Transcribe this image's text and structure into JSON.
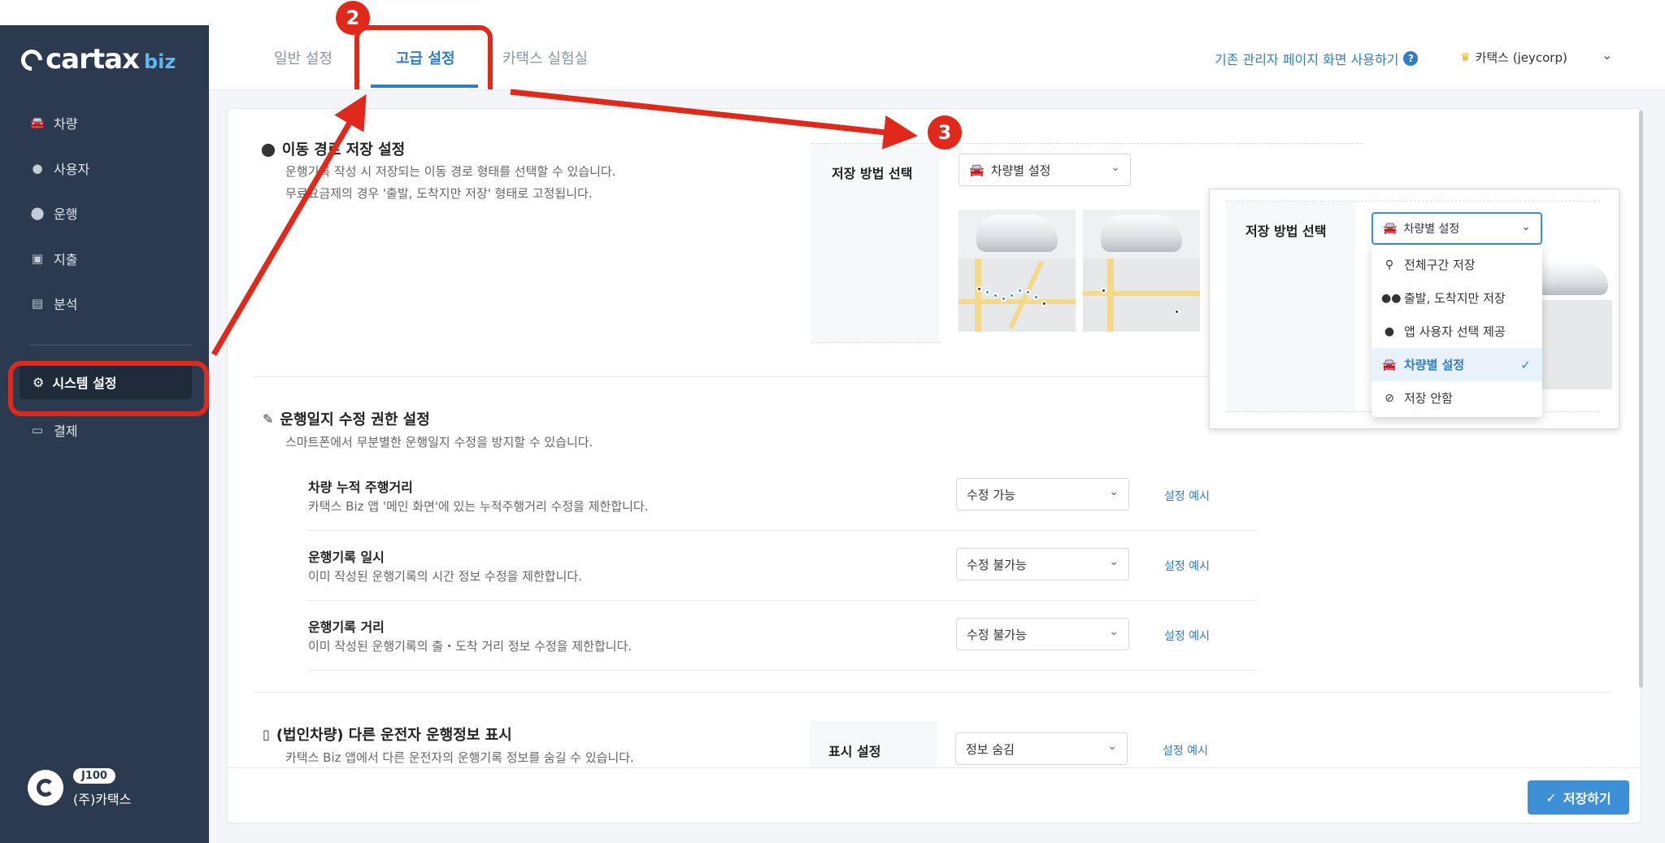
{
  "brand": {
    "name": "cartax",
    "suffix": "biz"
  },
  "sidebar": {
    "items": [
      {
        "label": "차량",
        "icon": "car-icon"
      },
      {
        "label": "사용자",
        "icon": "user-icon"
      },
      {
        "label": "운행",
        "icon": "location-pin-icon"
      },
      {
        "label": "지출",
        "icon": "expense-icon"
      },
      {
        "label": "분석",
        "icon": "chart-icon"
      }
    ],
    "system_settings": "시스템 설정",
    "payment": "결제",
    "user": {
      "plan": "J100",
      "company": "(주)카택스"
    }
  },
  "tabs": [
    {
      "label": "일반 설정",
      "active": false
    },
    {
      "label": "고급 설정",
      "active": true
    },
    {
      "label": "카택스 실험실",
      "active": false
    }
  ],
  "header": {
    "legacy_link": "기존 관리자 페이지 화면 사용하기",
    "account": "카택스 (jeycorp)"
  },
  "route_section": {
    "title": "이동 경로 저장 설정",
    "desc1": "운행기록 작성 시 저장되는 이동 경로 형태를 선택할 수 있습니다.",
    "desc2": "무료요금제의 경우 '출발, 도착지만 저장' 형태로 고정됩니다.",
    "option_label": "저장 방법 선택",
    "selected": "차량별 설정"
  },
  "popup": {
    "label": "저장 방법 선택",
    "selected": "차량별 설정",
    "options": [
      {
        "label": "전체구간 저장",
        "icon": "full-route-icon",
        "selected": false
      },
      {
        "label": "출발, 도착지만 저장",
        "icon": "start-end-pins-icon",
        "selected": false
      },
      {
        "label": "앱 사용자 선택 제공",
        "icon": "user-icon",
        "selected": false
      },
      {
        "label": "차량별 설정",
        "icon": "car-icon",
        "selected": true
      },
      {
        "label": "저장 안함",
        "icon": "ban-icon",
        "selected": false
      }
    ]
  },
  "edit_section": {
    "title": "운행일지 수정 권한 설정",
    "desc": "스마트폰에서 무분별한 운행일지 수정을 방지할 수 있습니다.",
    "rows": [
      {
        "title": "차량 누적 주행거리",
        "desc": "카택스 Biz 앱 '메인 화면'에 있는 누적주행거리 수정을 제한합니다.",
        "value": "수정 가능",
        "link": "설정 예시"
      },
      {
        "title": "운행기록 일시",
        "desc": "이미 작성된 운행기록의 시간 정보 수정을 제한합니다.",
        "value": "수정 불가능",
        "link": "설정 예시"
      },
      {
        "title": "운행기록 거리",
        "desc": "이미 작성된 운행기록의 출・도착 거리 정보 수정을 제한합니다.",
        "value": "수정 불가능",
        "link": "설정 예시"
      }
    ]
  },
  "driver_section": {
    "title": "(법인차량) 다른 운전자 운행정보 표시",
    "desc": "카택스 Biz 앱에서 다른 운전자의 운행기록 정보를 숨길 수 있습니다.",
    "option_label": "표시 설정",
    "value": "정보 숨김",
    "link": "설정 예시"
  },
  "footer": {
    "save": "저장하기"
  },
  "annotations": {
    "step2": "2",
    "step3": "3"
  },
  "colors": {
    "sidebar": "#2c3a4f",
    "accent": "#2f7dc9",
    "annotation": "#e0291a",
    "save": "#3d8fd6"
  }
}
